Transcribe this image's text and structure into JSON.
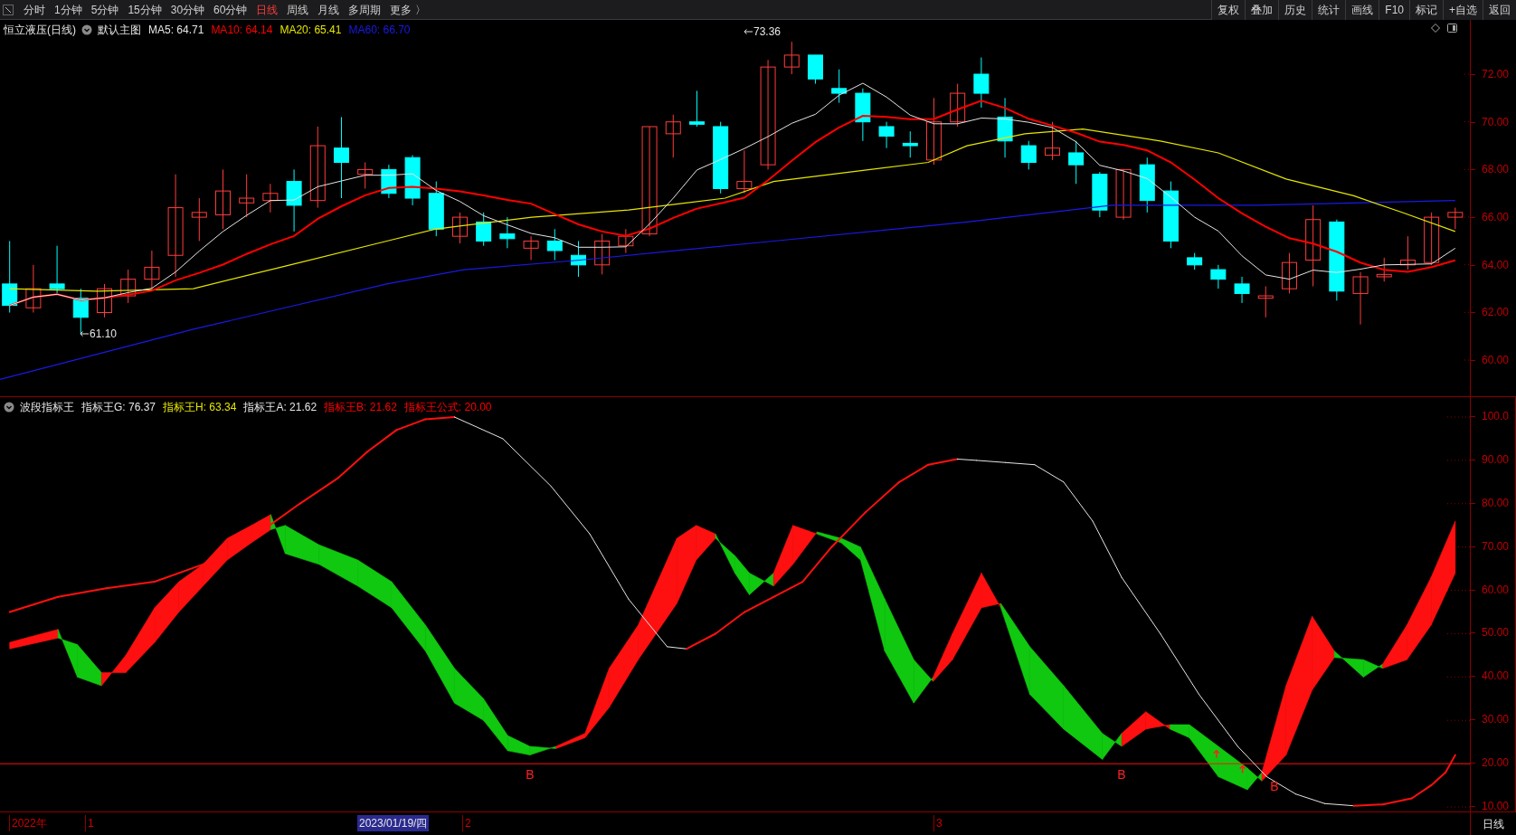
{
  "toolbar": {
    "periods": [
      {
        "label": "分时",
        "selected": false
      },
      {
        "label": "1分钟",
        "selected": false
      },
      {
        "label": "5分钟",
        "selected": false
      },
      {
        "label": "15分钟",
        "selected": false
      },
      {
        "label": "30分钟",
        "selected": false
      },
      {
        "label": "60分钟",
        "selected": false
      },
      {
        "label": "日线",
        "selected": true
      },
      {
        "label": "周线",
        "selected": false
      },
      {
        "label": "月线",
        "selected": false
      },
      {
        "label": "多周期",
        "selected": false
      }
    ],
    "more": "更多 〉",
    "buttons": [
      "复权",
      "叠加",
      "历史",
      "统计",
      "画线",
      "F10",
      "标记",
      "+自选",
      "返回"
    ]
  },
  "main_chart": {
    "legend": {
      "title": "恒立液压(日线)",
      "template": "默认主图",
      "items": [
        {
          "label": "MA5: 64.71",
          "color": "#e6e6e6"
        },
        {
          "label": "MA10: 64.14",
          "color": "#ff0000"
        },
        {
          "label": "MA20: 65.41",
          "color": "#e6e600"
        },
        {
          "label": "MA60: 66.70",
          "color": "#1a1ae6"
        }
      ]
    },
    "high_marker": "73.36",
    "low_marker": "61.10",
    "y_axis": [
      "72.00",
      "70.00",
      "68.00",
      "66.00",
      "64.00",
      "62.00",
      "60.00"
    ]
  },
  "indicator": {
    "legend": {
      "title": "波段指标王",
      "items": [
        {
          "label": "指标王G: 76.37",
          "color": "#e6e6e6"
        },
        {
          "label": "指标王H: 63.34",
          "color": "#e6e600"
        },
        {
          "label": "指标王A: 21.62",
          "color": "#e6e6e6"
        },
        {
          "label": "指标王B: 21.62",
          "color": "#ff0000"
        },
        {
          "label": "指标王公式: 20.00",
          "color": "#ff0000"
        }
      ]
    },
    "signals": [
      "B",
      "B",
      "B"
    ],
    "y_axis": [
      "100.0",
      "90.00",
      "80.00",
      "70.00",
      "60.00",
      "50.00",
      "40.00",
      "30.00",
      "20.00",
      "10.00"
    ]
  },
  "time_axis": {
    "labels": [
      {
        "label": "2022年",
        "highlighted": false
      },
      {
        "label": "1",
        "highlighted": false
      },
      {
        "label": "2023/01/19/四",
        "highlighted": true
      },
      {
        "label": "2",
        "highlighted": false
      },
      {
        "label": "3",
        "highlighted": false
      }
    ],
    "period": "日线"
  }
}
